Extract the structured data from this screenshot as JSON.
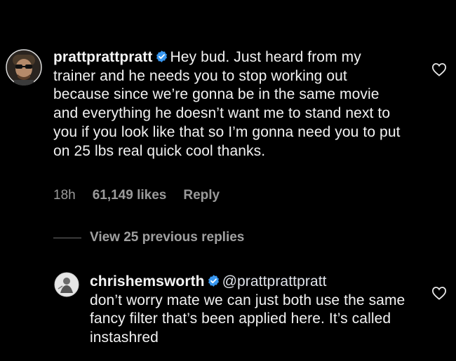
{
  "thread": {
    "comment": {
      "username": "prattprattpratt",
      "verified": true,
      "text": "Hey bud. Just heard from my trainer and he needs you to stop working out because since we’re gonna be in the same movie and everything he doesn’t want me to stand next to you if you look like that so I’m gonna need you to put on 25 lbs real quick cool thanks.",
      "time": "18h",
      "likes": "61,149 likes",
      "reply_label": "Reply"
    },
    "view_replies_label": "View 25 previous replies",
    "reply": {
      "username": "chrishemsworth",
      "verified": true,
      "mention": "@prattprattpratt",
      "text": "don’t worry mate we can just both use the same fancy filter that’s been applied here. It’s called instashred"
    }
  },
  "colors": {
    "background": "#000000",
    "text": "#f2f2f2",
    "secondary_text": "#9a9a9a",
    "verified_badge": "#3897f0"
  },
  "icons": {
    "like": "heart-outline-icon",
    "verified": "verified-badge-icon"
  }
}
